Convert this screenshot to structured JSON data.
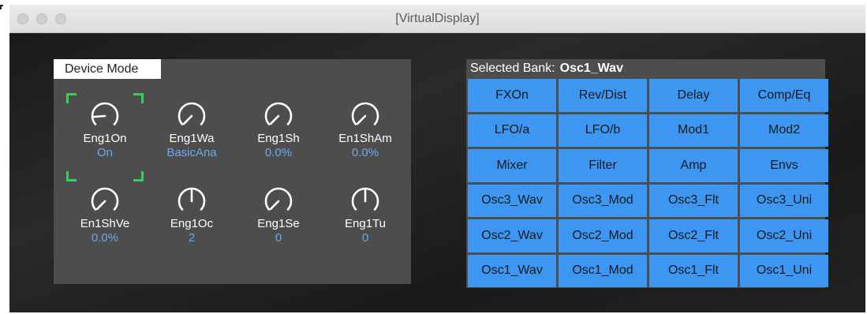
{
  "window": {
    "title": "[VirtualDisplay]"
  },
  "device": {
    "mode_label": "Device Mode",
    "params": [
      {
        "name": "Eng1On",
        "value": "On",
        "knob": 0.15,
        "selected": true
      },
      {
        "name": "Eng1Wa",
        "value": "BasicAna",
        "knob": 0.0,
        "selected": false
      },
      {
        "name": "Eng1Sh",
        "value": "0.0%",
        "knob": 0.0,
        "selected": false
      },
      {
        "name": "En1ShAm",
        "value": "0.0%",
        "knob": 0.0,
        "selected": false
      },
      {
        "name": "En1ShVe",
        "value": "0.0%",
        "knob": 0.0,
        "selected": false
      },
      {
        "name": "Eng1Oc",
        "value": "2",
        "knob": 0.5,
        "selected": false
      },
      {
        "name": "Eng1Se",
        "value": "0",
        "knob": 0.0,
        "selected": false
      },
      {
        "name": "Eng1Tu",
        "value": "0",
        "knob": 0.5,
        "selected": false
      }
    ]
  },
  "bank": {
    "label": "Selected Bank:",
    "selected": "Osc1_Wav",
    "buttons": [
      "FXOn",
      "Rev/Dist",
      "Delay",
      "Comp/Eq",
      "LFO/a",
      "LFO/b",
      "Mod1",
      "Mod2",
      "Mixer",
      "Filter",
      "Amp",
      "Envs",
      "Osc3_Wav",
      "Osc3_Mod",
      "Osc3_Flt",
      "Osc3_Uni",
      "Osc2_Wav",
      "Osc2_Mod",
      "Osc2_Flt",
      "Osc2_Uni",
      "Osc1_Wav",
      "Osc1_Mod",
      "Osc1_Flt",
      "Osc1_Uni"
    ]
  },
  "colors": {
    "button": "#3d97f2",
    "value_text": "#6aa8ee",
    "selection": "#2fd15a",
    "panel": "#4d4d4d"
  }
}
